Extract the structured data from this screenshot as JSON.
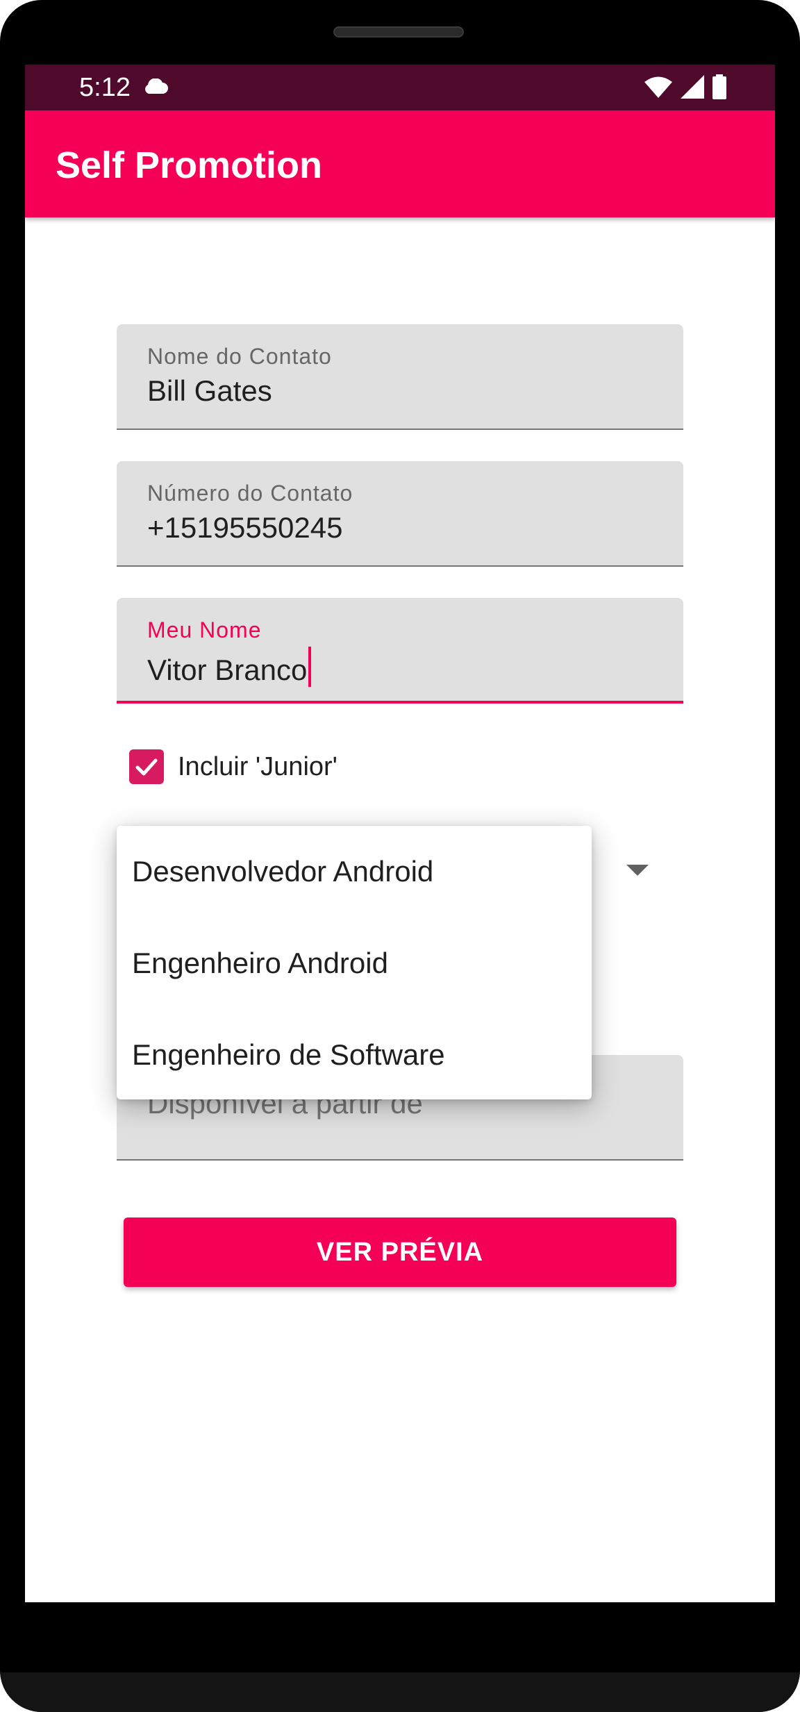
{
  "status_bar": {
    "time": "5:12",
    "icons": [
      "cloud-icon",
      "wifi-icon",
      "signal-icon",
      "battery-icon"
    ]
  },
  "app_bar": {
    "title": "Self Promotion"
  },
  "form": {
    "contact_name": {
      "label": "Nome do Contato",
      "value": "Bill Gates"
    },
    "contact_number": {
      "label": "Número do Contato",
      "value": "+15195550245"
    },
    "my_name": {
      "label": "Meu Nome",
      "value": "Vitor Branco"
    },
    "include_junior": {
      "label": "Incluir 'Junior'",
      "checked": true
    },
    "job_title_dropdown": {
      "options": [
        "Desenvolvedor Android",
        "Engenheiro Android",
        "Engenheiro de Software"
      ]
    },
    "available_from": {
      "placeholder": "Disponível a partir de"
    },
    "preview_button": {
      "label": "VER PRÉVIA"
    }
  },
  "colors": {
    "accent": "#f50057",
    "status_bar": "#4f0a2b",
    "checkbox": "#d81b60",
    "field_bg": "#e0e0e0"
  }
}
